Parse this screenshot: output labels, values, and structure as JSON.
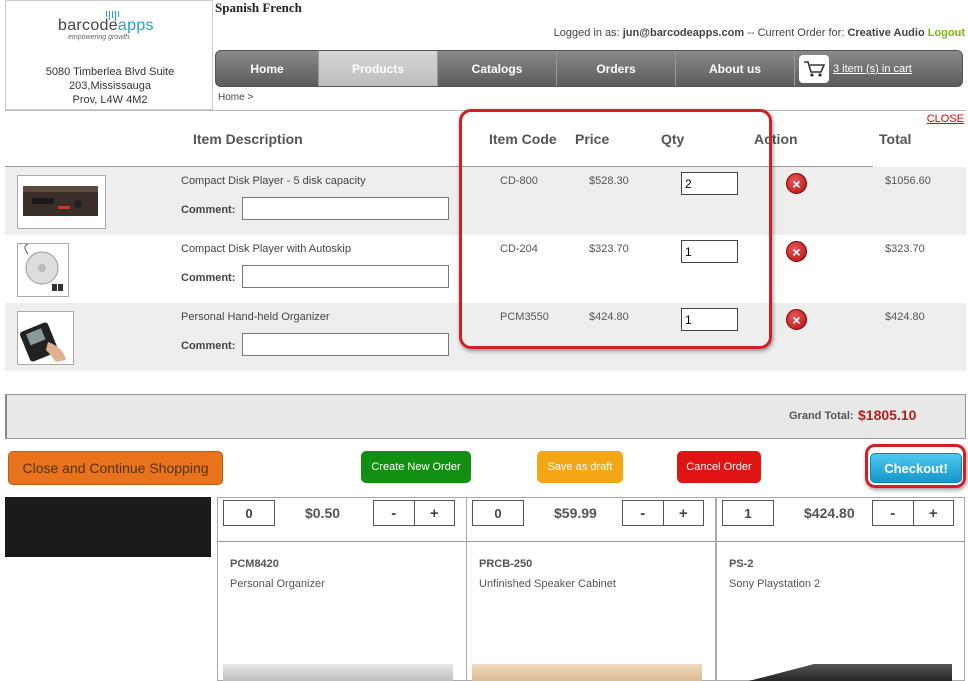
{
  "brand": {
    "name_part1": "barcode",
    "name_part2": "apps",
    "tagline": "empowering growth."
  },
  "address": {
    "line1": "5080 Timberlea Blvd Suite",
    "line2": "203,Mississauga",
    "line3": "Prov, L4W 4M2"
  },
  "language_link": "Spanish French",
  "login": {
    "prefix": "Logged in as:",
    "user": "jun@barcodeapps.com",
    "separator": "-- Current Order for:",
    "customer": "Creative Audio",
    "logout": "Logout"
  },
  "nav": {
    "home": "Home",
    "products": "Products",
    "catalogs": "Catalogs",
    "orders": "Orders",
    "about": "About us",
    "cart": "3 item (s) in cart"
  },
  "breadcrumb": "Home >",
  "cart": {
    "close": "CLOSE",
    "headers": {
      "description": "Item Description",
      "code": "Item Code",
      "price": "Price",
      "qty": "Qty",
      "action": "Action",
      "total": "Total"
    },
    "comment_label": "Comment:",
    "items": [
      {
        "description": "Compact Disk Player - 5 disk capacity",
        "code": "CD-800",
        "price": "$528.30",
        "qty": "2",
        "total": "$1056.60",
        "image": "cd-player-icon"
      },
      {
        "description": "Compact Disk Player with Autoskip",
        "code": "CD-204",
        "price": "$323.70",
        "qty": "1",
        "total": "$323.70",
        "image": "portable-cd-icon"
      },
      {
        "description": "Personal Hand-held Organizer",
        "code": "PCM3550",
        "price": "$424.80",
        "qty": "1",
        "total": "$424.80",
        "image": "organizer-icon"
      }
    ],
    "grand_total_label": "Grand Total:",
    "grand_total": "$1805.10",
    "buttons": {
      "continue": "Close and Continue Shopping",
      "new_order": "Create New Order",
      "draft": "Save as draft",
      "cancel": "Cancel Order",
      "checkout": "Checkout!"
    }
  },
  "products": [
    {
      "count": "0",
      "price": "$0.50",
      "code": "PCM8420",
      "name": "Personal Organizer"
    },
    {
      "count": "0",
      "price": "$59.99",
      "code": "PRCB-250",
      "name": "Unfinished Speaker Cabinet"
    },
    {
      "count": "1",
      "price": "$424.80",
      "code": "PS-2",
      "name": "Sony Playstation 2"
    }
  ],
  "stepper": {
    "minus": "-",
    "plus": "+"
  },
  "colors": {
    "highlight": "#d21f27",
    "checkout": "#1596c8",
    "grand_total": "#b02020",
    "logout": "#7cb800"
  }
}
